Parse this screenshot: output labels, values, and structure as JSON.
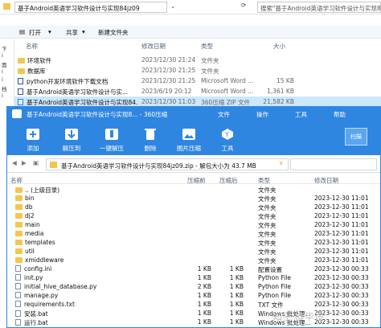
{
  "explorer": {
    "address": "基于Android英语学习软件设计与实现84jz09",
    "search_placeholder": "搜索\"基于Android英语学习软件设计与实现84jz09\"",
    "toolbar": {
      "open": "打开",
      "share": "共享",
      "new_folder": "新建文件夹"
    },
    "sidebar": [
      "下",
      "i",
      "面",
      "i",
      "i",
      "档",
      "i",
      "(C:",
      "(D:",
      "(E:",
      "(F:",
      "(G:",
      "(H:",
      "(I:"
    ],
    "columns": {
      "name": "名称",
      "modified": "修改日期",
      "type": "类型",
      "size": "大小"
    },
    "files": [
      {
        "name": "环境软件",
        "date": "2023/12/30 21:24",
        "type": "文件夹",
        "size": ""
      },
      {
        "name": "数据库",
        "date": "2023/12/30 21:25",
        "type": "文件夹",
        "size": ""
      },
      {
        "name": "python开发环境软件下载文档",
        "date": "2023/12/30 21:25",
        "type": "Microsoft Word ...",
        "size": "15 KB"
      },
      {
        "name": "基于Android英语学习软件设计与实...",
        "date": "2023/6/19 20:12",
        "type": "Microsoft Word ...",
        "size": "1,361 KB"
      },
      {
        "name": "基于Android英语学习软件设计与实现84...",
        "date": "2023/12/30 11:03",
        "type": "360压缩 ZIP 文件",
        "size": "21,582 KB"
      }
    ]
  },
  "zip": {
    "title": "基于Android英语学习软件设计与实现8... - 360压缩",
    "menu": {
      "file": "文件",
      "ops": "操作",
      "tools": "工具",
      "help": "帮助"
    },
    "tools": [
      "添加",
      "解压到",
      "一键解压",
      "删除",
      "图片压缩",
      "工具"
    ],
    "badge": "扫描",
    "path": "基于Android英语学习软件设计与实现84jz09.zip - 解包大小为 43.7 MB",
    "columns": {
      "name": "名称",
      "before": "压缩前",
      "after": "压缩后",
      "type": "类型",
      "modified": "修改日期"
    },
    "rows": [
      {
        "name": ".. (上级目录)",
        "before": "",
        "after": "",
        "type": "文件夹",
        "date": "",
        "folder": true
      },
      {
        "name": "bin",
        "before": "",
        "after": "",
        "type": "文件夹",
        "date": "2023-12-30 11:01",
        "folder": true
      },
      {
        "name": "db",
        "before": "",
        "after": "",
        "type": "文件夹",
        "date": "2023-12-30 11:01",
        "folder": true
      },
      {
        "name": "dj2",
        "before": "",
        "after": "",
        "type": "文件夹",
        "date": "2023-12-30 11:01",
        "folder": true
      },
      {
        "name": "main",
        "before": "",
        "after": "",
        "type": "文件夹",
        "date": "2023-12-30 11:01",
        "folder": true
      },
      {
        "name": "media",
        "before": "",
        "after": "",
        "type": "文件夹",
        "date": "2023-12-30 11:01",
        "folder": true
      },
      {
        "name": "templates",
        "before": "",
        "after": "",
        "type": "文件夹",
        "date": "2023-12-30 11:01",
        "folder": true
      },
      {
        "name": "util",
        "before": "",
        "after": "",
        "type": "文件夹",
        "date": "2023-12-30 11:01",
        "folder": true
      },
      {
        "name": "xmiddleware",
        "before": "",
        "after": "",
        "type": "文件夹",
        "date": "2023-12-30 11:01",
        "folder": true
      },
      {
        "name": "config.ini",
        "before": "1 KB",
        "after": "1 KB",
        "type": "配置设置",
        "date": "2023-12-30 00:33",
        "folder": false
      },
      {
        "name": "init.py",
        "before": "1 KB",
        "after": "1 KB",
        "type": "Python File",
        "date": "2023-12-30 00:33",
        "folder": false
      },
      {
        "name": "initial_hive_database.py",
        "before": "2 KB",
        "after": "1 KB",
        "type": "Python File",
        "date": "2023-12-30 00:33",
        "folder": false
      },
      {
        "name": "manage.py",
        "before": "1 KB",
        "after": "1 KB",
        "type": "Python File",
        "date": "2023-12-30 00:33",
        "folder": false
      },
      {
        "name": "requirements.txt",
        "before": "1 KB",
        "after": "1 KB",
        "type": "TXT 文件",
        "date": "2023-12-30 00:33",
        "folder": false
      },
      {
        "name": "安装.bat",
        "before": "1 KB",
        "after": "1 KB",
        "type": "Windows 批处理...",
        "date": "2023-12-30 00:33",
        "folder": false
      },
      {
        "name": "运行.bat",
        "before": "1 KB",
        "after": "1 KB",
        "type": "Windows 批处理...",
        "date": "2023-12-30 00:33",
        "folder": false
      }
    ]
  },
  "watermark": "知乎 @毕设",
  "colors": {
    "accent": "#2f86e0",
    "selection": "#cce8ff",
    "folder": "#f3c74f"
  }
}
